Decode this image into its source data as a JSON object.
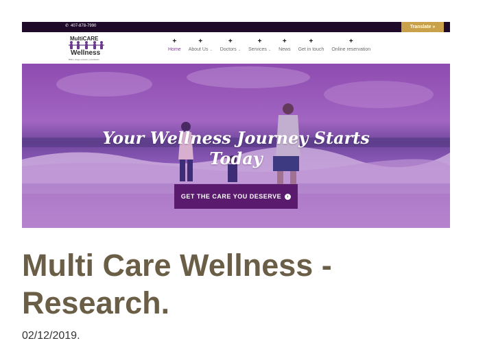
{
  "topbar": {
    "phone": "407-878-7990",
    "translate_label": "Translate »"
  },
  "logo": {
    "line1": "MultiCARE",
    "line2": "Wellness",
    "tagline": "BMC | drugs reviews | prosthetics"
  },
  "nav": {
    "items": [
      {
        "label": "Home",
        "active": true,
        "dropdown": false
      },
      {
        "label": "About Us",
        "active": false,
        "dropdown": true
      },
      {
        "label": "Doctors",
        "active": false,
        "dropdown": true
      },
      {
        "label": "Services",
        "active": false,
        "dropdown": true
      },
      {
        "label": "News",
        "active": false,
        "dropdown": false
      },
      {
        "label": "Get in touch",
        "active": false,
        "dropdown": false
      },
      {
        "label": "Online reservation",
        "active": false,
        "dropdown": false
      }
    ]
  },
  "hero": {
    "title_line1": "Your Wellness Journey Starts",
    "title_line2": "Today",
    "cta_label": "GET THE CARE YOU DESERVE"
  },
  "article": {
    "title": "Multi Care Wellness - Research.",
    "date": "02/12/2019."
  },
  "colors": {
    "topbar": "#1f0a2a",
    "translate": "#c8a14a",
    "brand_purple": "#5a1a6e",
    "nav_active": "#7c3e90",
    "title": "#6b5e46"
  },
  "icons": [
    "phone-icon",
    "plus-icon",
    "chevron-down-icon",
    "arrow-circle-icon"
  ]
}
